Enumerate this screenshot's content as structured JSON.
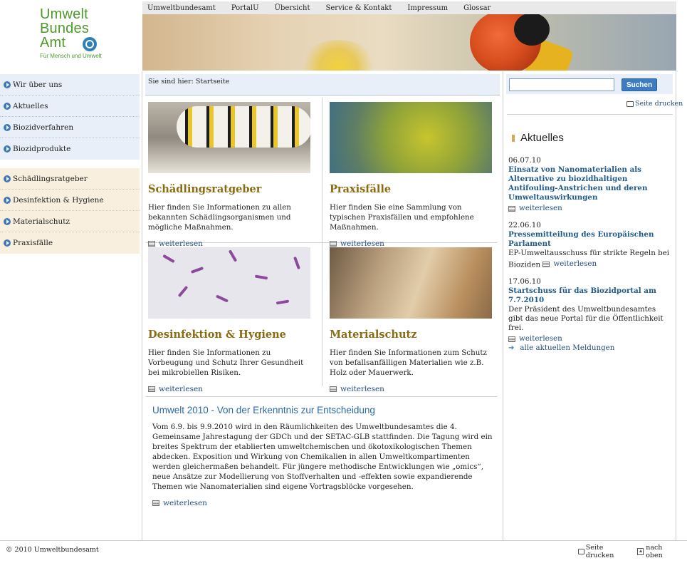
{
  "logo": {
    "line1": "Umwelt",
    "line2": "Bundes",
    "line3": "Amt",
    "tagline": "Für Mensch und Umwelt"
  },
  "topnav": [
    "Umweltbundesamt",
    "PortalU",
    "Übersicht",
    "Service & Kontakt",
    "Impressum",
    "Glossar"
  ],
  "leftnav_primary": [
    "Wir über uns",
    "Aktuelles",
    "Biozidverfahren",
    "Biozidprodukte"
  ],
  "leftnav_secondary": [
    "Schädlingsratgeber",
    "Desinfektion & Hygiene",
    "Materialschutz",
    "Praxisfälle"
  ],
  "breadcrumb": "Sie sind hier: Startseite",
  "teasers": [
    {
      "title": "Schädlingsratgeber",
      "text": "Hier finden Sie Informationen zu allen bekannten Schädlingsorganismen und mögliche Maßnahmen.",
      "more": "weiterlesen"
    },
    {
      "title": "Praxisfälle",
      "text": "Hier finden Sie eine Sammlung von typischen Praxisfällen und empfohlene Maßnahmen.",
      "more": "weiterlesen"
    },
    {
      "title": "Desinfektion & Hygiene",
      "text": "Hier finden Sie Informationen zu Vorbeugung und Schutz Ihrer Gesundheit bei mikrobiellen Risiken.",
      "more": "weiterlesen"
    },
    {
      "title": "Materialschutz",
      "text": "Hier finden Sie Informationen zum Schutz von befallsanfälligen Materialien wie z.B. Holz oder Mauerwerk.",
      "more": "weiterlesen"
    }
  ],
  "feature": {
    "title": "Umwelt 2010 - Von der Erkenntnis zur Entscheidung",
    "text": "Vom 6.9. bis 9.9.2010 wird in den Räumlichkeiten des Umweltbundesamtes die 4. Gemeinsame Jahrestagung der GDCh und der SETAC-GLB stattfinden. Die Tagung wird ein breites Spektrum der etablierten umweltchemischen und ökotoxikologischen Themen abdecken. Exposition und Wirkung von Chemikalien in allen Umweltkompartimenten werden gleichermaßen behandelt. Für jüngere methodische Entwicklungen wie „omics“, neue Ansätze zur Modellierung von Stoffverhalten und -effekten sowie expandierende Themen wie Nanomaterialien sind eigene Vortragsblöcke vorgesehen.",
    "more": "weiterlesen"
  },
  "search": {
    "placeholder": "",
    "button": "Suchen"
  },
  "print_top": "Seite drucken",
  "news_heading": "Aktuelles",
  "news": [
    {
      "date": "06.07.10",
      "title": "Einsatz von Nanomaterialien als Alternative zu biozidhaltigen Antifouling-Anstrichen und deren Umweltauswirkungen",
      "text": "",
      "more": "weiterlesen"
    },
    {
      "date": "22.06.10",
      "title": "Pressemitteilung des Europäischen Parlament",
      "text": "EP-Umweltausschuss für strikte Regeln bei Bioziden",
      "more": "weiterlesen"
    },
    {
      "date": "17.06.10",
      "title": "Startschuss für das Biozidportal am 7.7.2010",
      "text": "Der Präsident des Umweltbundesamtes gibt das neue Portal für die Öffentlichkeit frei.",
      "more": "weiterlesen"
    }
  ],
  "all_news": "alle aktuellen Meldungen",
  "footer": {
    "copyright": "© 2010 Umweltbundesamt",
    "print": "Seite drucken",
    "top": "nach oben"
  },
  "colors": {
    "nav_blue_bg": "#e8eff8",
    "nav_beige_bg": "#f8efdf",
    "teaser_title": "#8a6b12",
    "link_blue": "#1f5a8a",
    "logo_green": "#4f9a2e"
  }
}
